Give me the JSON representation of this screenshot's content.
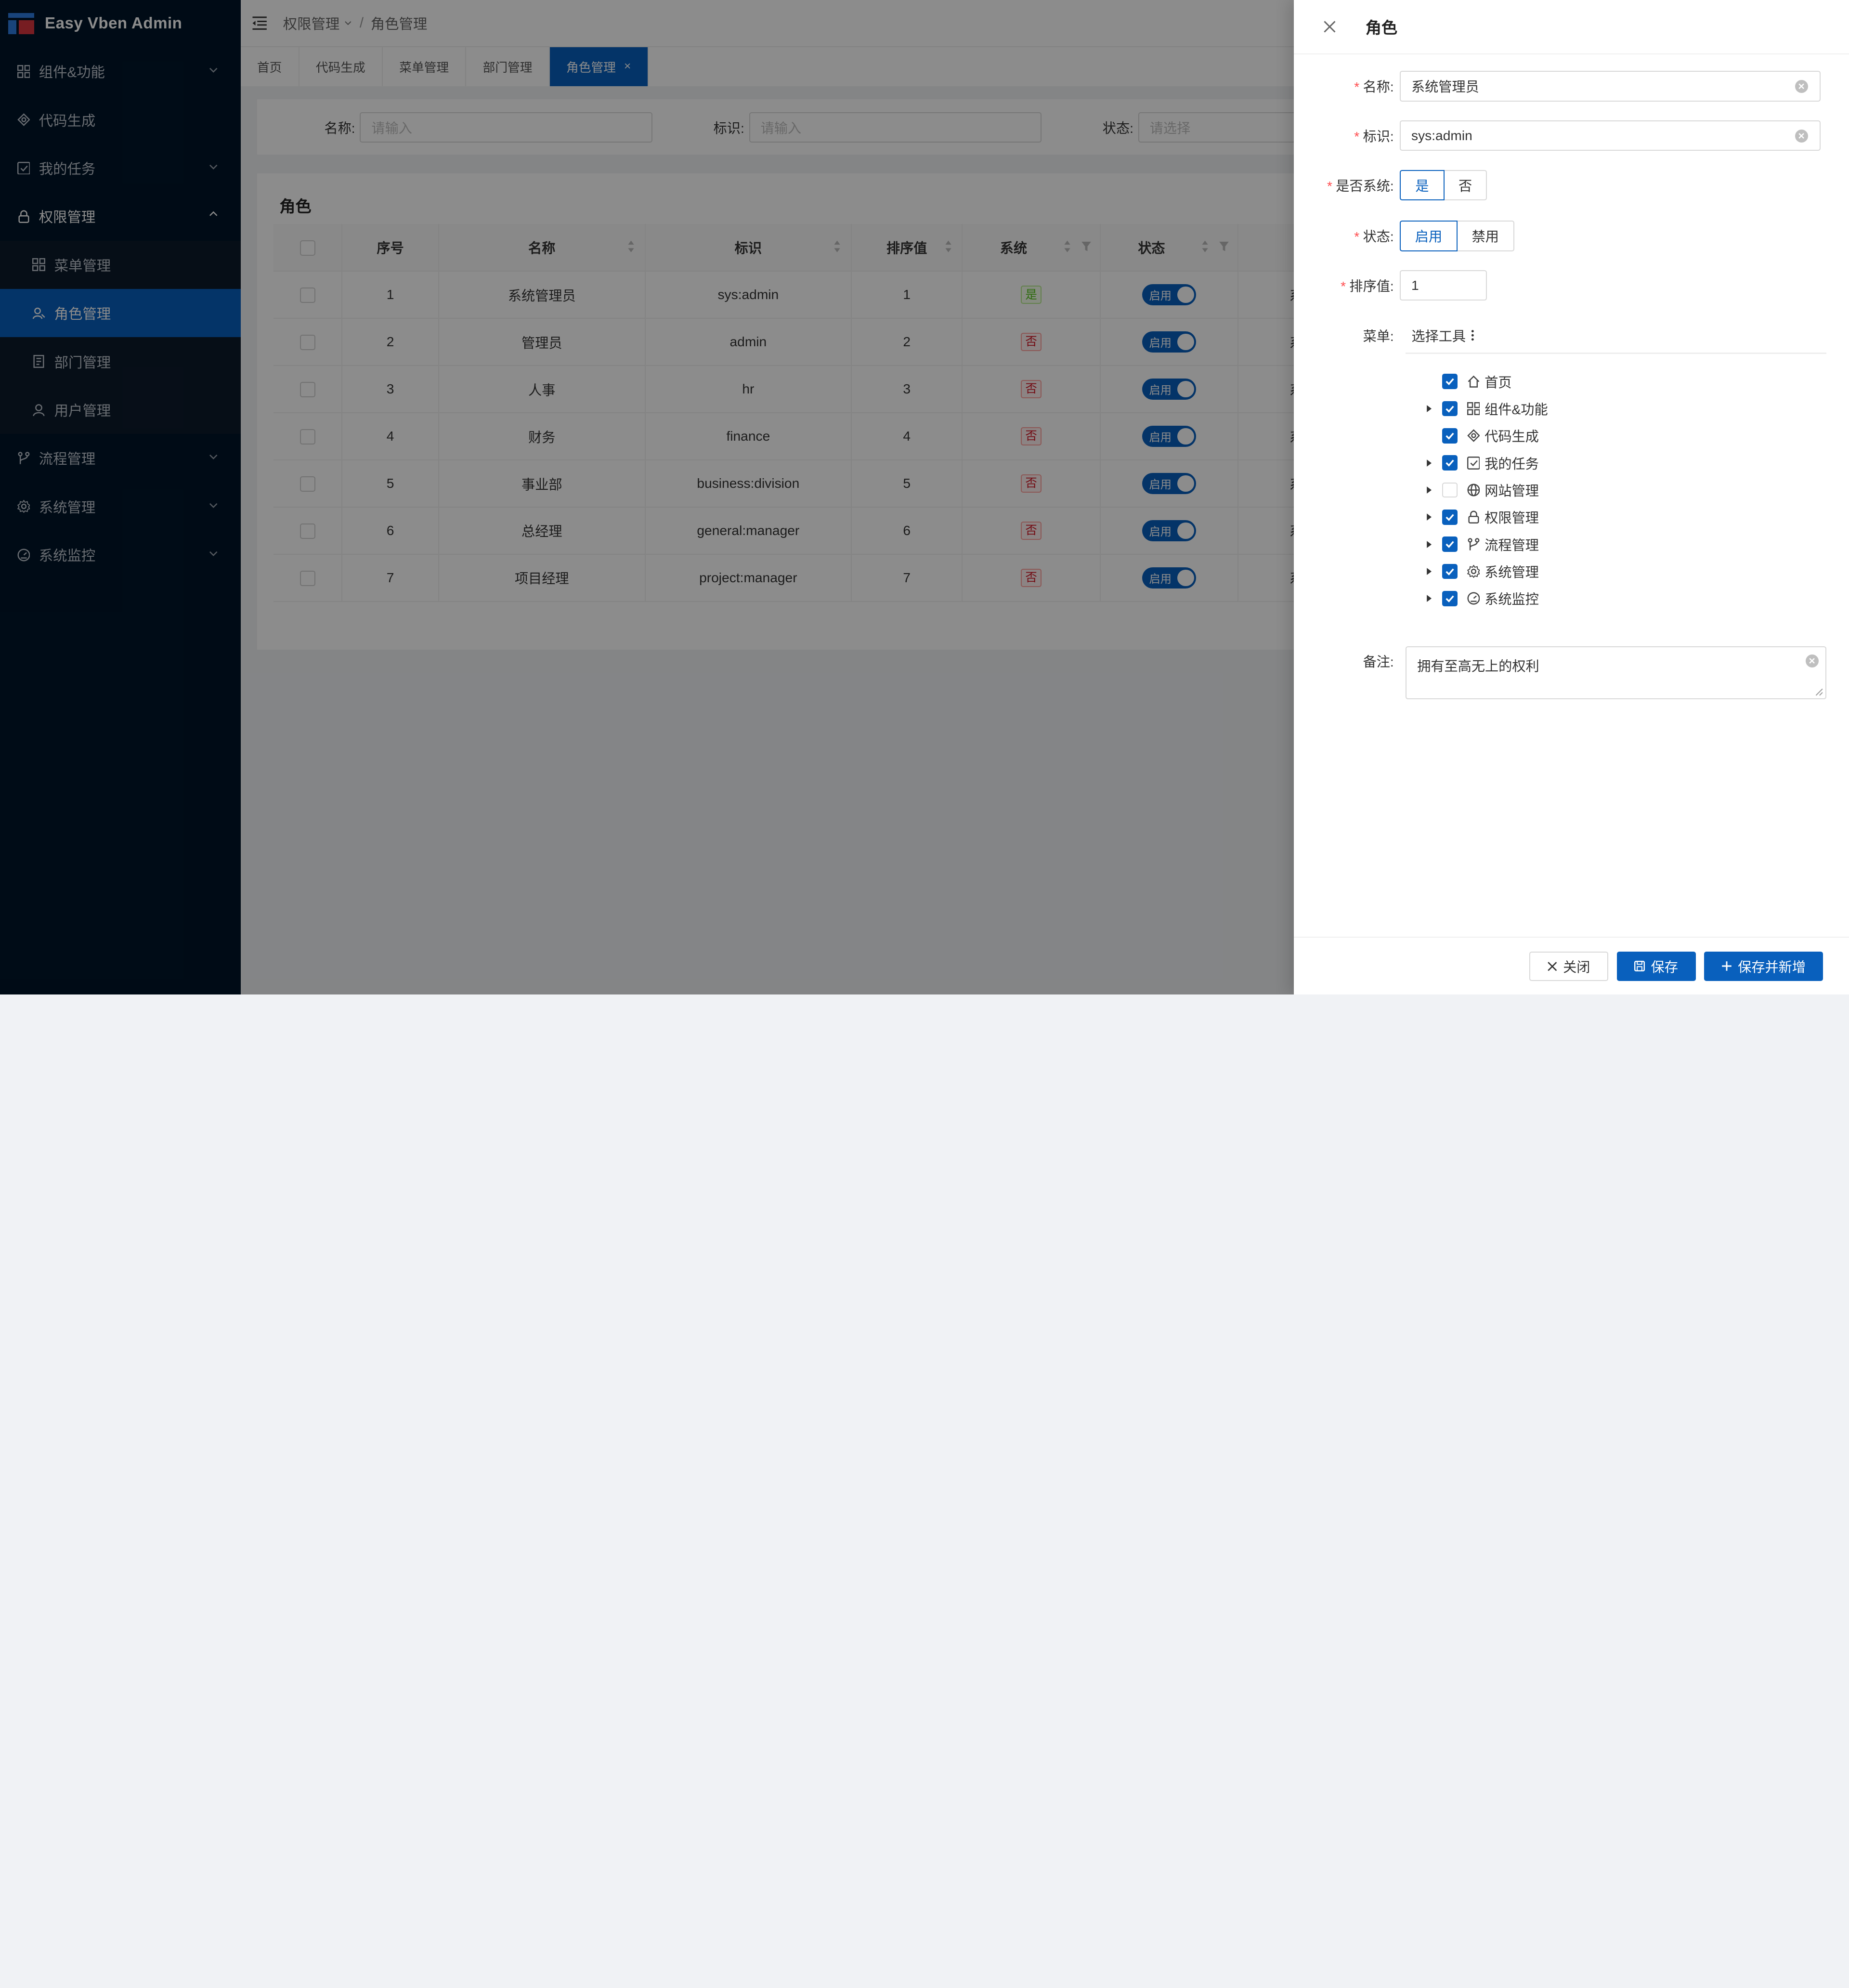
{
  "app": {
    "title": "Easy Vben Admin"
  },
  "sidebar": {
    "items": [
      {
        "label": "组件&功能",
        "icon": "grid-icon",
        "has_children": true
      },
      {
        "label": "代码生成",
        "icon": "codegen-icon",
        "has_children": false
      },
      {
        "label": "我的任务",
        "icon": "task-icon",
        "has_children": true
      },
      {
        "label": "权限管理",
        "icon": "lock-icon",
        "has_children": true,
        "expanded": true
      },
      {
        "label": "流程管理",
        "icon": "branch-icon",
        "has_children": true
      },
      {
        "label": "系统管理",
        "icon": "gear-icon",
        "has_children": true
      },
      {
        "label": "系统监控",
        "icon": "dashboard-icon",
        "has_children": true
      }
    ],
    "submenu": [
      {
        "label": "菜单管理",
        "icon": "grid-icon"
      },
      {
        "label": "角色管理",
        "icon": "role-icon",
        "active": true
      },
      {
        "label": "部门管理",
        "icon": "dept-icon"
      },
      {
        "label": "用户管理",
        "icon": "user-icon"
      }
    ]
  },
  "header": {
    "breadcrumb": [
      "权限管理",
      "角色管理"
    ]
  },
  "tabs": [
    {
      "label": "首页"
    },
    {
      "label": "代码生成"
    },
    {
      "label": "菜单管理"
    },
    {
      "label": "部门管理"
    },
    {
      "label": "角色管理",
      "active": true,
      "close": "×"
    }
  ],
  "search": {
    "name_label": "名称:",
    "name_placeholder": "请输入",
    "code_label": "标识:",
    "code_placeholder": "请输入",
    "status_label": "状态:",
    "status_placeholder": "请选择"
  },
  "table": {
    "title": "角色",
    "columns": [
      "序号",
      "名称",
      "标识",
      "排序值",
      "系统",
      "状态"
    ],
    "rows": [
      {
        "no": "1",
        "name": "系统管理员",
        "code": "sys:admin",
        "sort": "1",
        "system": "是",
        "status": "启用"
      },
      {
        "no": "2",
        "name": "管理员",
        "code": "admin",
        "sort": "2",
        "system": "否",
        "status": "启用"
      },
      {
        "no": "3",
        "name": "人事",
        "code": "hr",
        "sort": "3",
        "system": "否",
        "status": "启用"
      },
      {
        "no": "4",
        "name": "财务",
        "code": "finance",
        "sort": "4",
        "system": "否",
        "status": "启用"
      },
      {
        "no": "5",
        "name": "事业部",
        "code": "business:division",
        "sort": "5",
        "system": "否",
        "status": "启用"
      },
      {
        "no": "6",
        "name": "总经理",
        "code": "general:manager",
        "sort": "6",
        "system": "否",
        "status": "启用"
      },
      {
        "no": "7",
        "name": "项目经理",
        "code": "project:manager",
        "sort": "7",
        "system": "否",
        "status": "启用"
      }
    ],
    "truncated_cell": "系"
  },
  "drawer": {
    "title": "角色",
    "fields": {
      "name_label": "名称:",
      "name_value": "系统管理员",
      "code_label": "标识:",
      "code_value": "sys:admin",
      "is_system_label": "是否系统:",
      "is_system_options": [
        "是",
        "否"
      ],
      "is_system_selected": "是",
      "status_label": "状态:",
      "status_options": [
        "启用",
        "禁用"
      ],
      "status_selected": "启用",
      "sort_label": "排序值:",
      "sort_value": "1",
      "menu_label": "菜单:",
      "menu_tool": "选择工具",
      "remark_label": "备注:",
      "remark_value": "拥有至高无上的权利"
    },
    "menu_tree": [
      {
        "label": "首页",
        "icon": "home-icon",
        "checked": true,
        "expandable": false
      },
      {
        "label": "组件&功能",
        "icon": "grid-icon",
        "checked": true,
        "expandable": true
      },
      {
        "label": "代码生成",
        "icon": "codegen-icon",
        "checked": true,
        "expandable": false
      },
      {
        "label": "我的任务",
        "icon": "task-icon",
        "checked": true,
        "expandable": true
      },
      {
        "label": "网站管理",
        "icon": "globe-icon",
        "checked": false,
        "expandable": true
      },
      {
        "label": "权限管理",
        "icon": "lock-icon",
        "checked": true,
        "expandable": true
      },
      {
        "label": "流程管理",
        "icon": "branch-icon",
        "checked": true,
        "expandable": true
      },
      {
        "label": "系统管理",
        "icon": "gear-icon",
        "checked": true,
        "expandable": true
      },
      {
        "label": "系统监控",
        "icon": "dashboard-icon",
        "checked": true,
        "expandable": true
      }
    ],
    "footer": {
      "close_label": "关闭",
      "save_label": "保存",
      "save_new_label": "保存并新增"
    }
  },
  "colors": {
    "primary": "#0960bd",
    "sidebar_bg": "#001529",
    "danger": "#ff4d4f"
  }
}
